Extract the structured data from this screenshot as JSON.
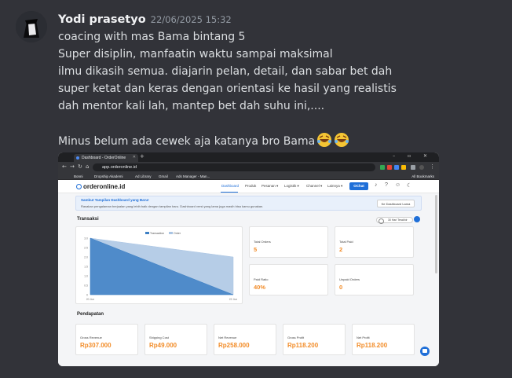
{
  "message": {
    "username": "Yodi prasetyo",
    "timestamp": "22/06/2025 15:32",
    "lines": [
      "coacing with mas Bama bintang 5",
      "Super disiplin, manfaatin waktu sampai maksimal",
      "ilmu dikasih semua. diajarin pelan, detail, dan sabar bet dah",
      "super ketat dan keras dengan orientasi ke hasil yang realistis",
      "dah mentor kali lah, mantep bet dah suhu ini,....",
      "",
      "Minus belum ada cewek aja katanya bro Bama"
    ],
    "emoji_icons": [
      "rolling-on-floor-laughing-emoji",
      "rolling-on-floor-laughing-emoji"
    ]
  },
  "browser": {
    "tab_title": "Dashboard - OrderOnline",
    "url": "app.orderonline.id",
    "bookmarks": [
      "Bonni",
      "Dropship Akademi",
      "Ad Library",
      "Gmail",
      "Ads Manager - Man..."
    ],
    "all_bookmarks": "All Bookmarks"
  },
  "app": {
    "logo": "orderonline.id",
    "nav": [
      "Dashboard",
      "Produk",
      "Pesanan ▾",
      "Logistik ▾",
      "Channel ▾",
      "Lainnya ▾"
    ],
    "ochat": "OChat",
    "banner_title": "Sambut Tampilan Dashboard yang Baru!",
    "banner_sub": "Rasakan pengalaman berjualan yang lebih baik dengan tampilan baru. Dashboard versi yang lama juga masih bisa kamu gunakan.",
    "banner_button": "Ke Dashboard Lama",
    "transaksi_title": "Transaksi",
    "range_toggle": "30 Hari Terakhir",
    "stats": [
      {
        "label": "Total Orders",
        "value": "5"
      },
      {
        "label": "Total Paid",
        "value": "2"
      },
      {
        "label": "Paid Ratio",
        "value": "40%"
      },
      {
        "label": "Unpaid Orders",
        "value": "0"
      }
    ],
    "pendapatan_title": "Pendapatan",
    "revenue": [
      {
        "label": "Gross Revenue",
        "value": "Rp307.000"
      },
      {
        "label": "Shipping Cost",
        "value": "Rp49.000"
      },
      {
        "label": "Net Revenue",
        "value": "Rp258.000"
      },
      {
        "label": "Gross Profit",
        "value": "Rp118.200"
      },
      {
        "label": "Net Profit",
        "value": "Rp118.200"
      }
    ]
  },
  "chart_data": {
    "type": "area",
    "x": [
      "20 Jun",
      "22 Jun"
    ],
    "series": [
      {
        "name": "Transaction",
        "values": [
          5,
          0
        ],
        "color": "#3d7fc4"
      },
      {
        "name": "Order",
        "values": [
          5,
          2
        ],
        "color": "#a9c4e3"
      }
    ],
    "ylim": [
      0,
      3.0
    ],
    "yticks": [
      "3.0",
      "2.5",
      "2.0",
      "1.5",
      "1.0",
      "0.5",
      "0"
    ],
    "legend": "top-center",
    "grid": false
  }
}
